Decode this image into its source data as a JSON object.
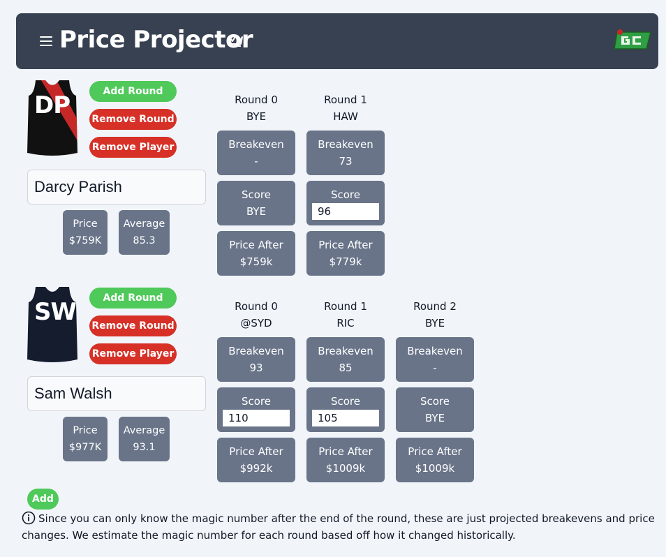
{
  "header": {
    "title": "Price Projector"
  },
  "players": [
    {
      "initials": "DP",
      "name": "Darcy Parish",
      "buttons": {
        "add_round": "Add Round",
        "remove_round": "Remove Round",
        "remove_player": "Remove Player"
      },
      "stats": {
        "price_label": "Price",
        "price": "$759K",
        "average_label": "Average",
        "average": "85.3"
      },
      "rounds": [
        {
          "round": "Round 0",
          "opponent": "BYE",
          "breakeven_label": "Breakeven",
          "breakeven": "-",
          "score_label": "Score",
          "score": "BYE",
          "score_editable": false,
          "price_after_label": "Price After",
          "price_after": "$759k"
        },
        {
          "round": "Round 1",
          "opponent": "HAW",
          "breakeven_label": "Breakeven",
          "breakeven": "73",
          "score_label": "Score",
          "score": "96",
          "score_editable": true,
          "price_after_label": "Price After",
          "price_after": "$779k"
        }
      ]
    },
    {
      "initials": "SW",
      "name": "Sam Walsh",
      "buttons": {
        "add_round": "Add Round",
        "remove_round": "Remove Round",
        "remove_player": "Remove Player"
      },
      "stats": {
        "price_label": "Price",
        "price": "$977K",
        "average_label": "Average",
        "average": "93.1"
      },
      "rounds": [
        {
          "round": "Round 0",
          "opponent": "@SYD",
          "breakeven_label": "Breakeven",
          "breakeven": "93",
          "score_label": "Score",
          "score": "110",
          "score_editable": true,
          "price_after_label": "Price After",
          "price_after": "$992k"
        },
        {
          "round": "Round 1",
          "opponent": "RIC",
          "breakeven_label": "Breakeven",
          "breakeven": "85",
          "score_label": "Score",
          "score": "105",
          "score_editable": true,
          "price_after_label": "Price After",
          "price_after": "$1009k"
        },
        {
          "round": "Round 2",
          "opponent": "BYE",
          "breakeven_label": "Breakeven",
          "breakeven": "-",
          "score_label": "Score",
          "score": "BYE",
          "score_editable": false,
          "price_after_label": "Price After",
          "price_after": "$1009k"
        }
      ]
    }
  ],
  "add_button": "Add",
  "info_text": "Since you can only know the magic number after the end of the round, these are just projected breakevens and price changes. We estimate the magic number for each round based off how it changed historically.",
  "colors": {
    "header": "#374151",
    "cell": "#697489",
    "green": "#4ec95a",
    "red": "#d63027"
  },
  "icons": [
    "menu-icon",
    "crown-icon",
    "info-icon"
  ]
}
